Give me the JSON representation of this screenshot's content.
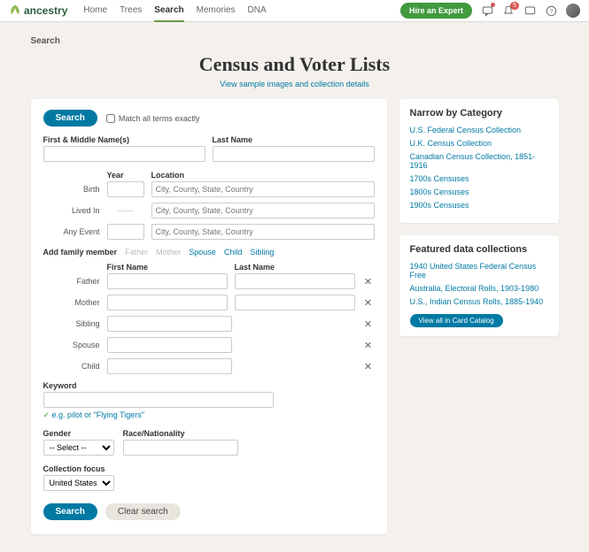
{
  "brand": "ancestry",
  "nav": {
    "home": "Home",
    "trees": "Trees",
    "search": "Search",
    "memories": "Memories",
    "dna": "DNA"
  },
  "hire": "Hire an Expert",
  "notif_count": "5",
  "breadcrumb": "Search",
  "title": "Census and Voter Lists",
  "sample_link": "View sample images and collection details",
  "search_btn": "Search",
  "clear_btn": "Clear search",
  "match_exact": "Match all terms exactly",
  "labels": {
    "first_middle": "First & Middle Name(s)",
    "last_name": "Last Name",
    "year": "Year",
    "location": "Location",
    "birth": "Birth",
    "lived_in": "Lived In",
    "any_event": "Any Event",
    "add_family": "Add family member",
    "first_name": "First Name",
    "father": "Father",
    "mother": "Mother",
    "sibling": "Sibling",
    "spouse": "Spouse",
    "child": "Child",
    "keyword": "Keyword",
    "keyword_tip": "e.g. pilot or \"Flying Tigers\"",
    "gender": "Gender",
    "race": "Race/Nationality",
    "collection_focus": "Collection focus"
  },
  "placeholders": {
    "location": "City, County, State, Country"
  },
  "family_links": {
    "father": "Father",
    "mother": "Mother",
    "spouse": "Spouse",
    "child": "Child",
    "sibling": "Sibling"
  },
  "gender_default": "-- Select --",
  "collection_default": "United States",
  "narrow": {
    "title": "Narrow by Category",
    "items": [
      "U.S. Federal Census Collection",
      "U.K. Census Collection",
      "Canadian Census Collection, 1851-1916",
      "1700s Censuses",
      "1800s Censuses",
      "1900s Censuses"
    ]
  },
  "featured": {
    "title": "Featured data collections",
    "items": [
      "1940 United States Federal Census Free",
      "Australia, Electoral Rolls, 1903-1980",
      "U.S., Indian Census Rolls, 1885-1940"
    ],
    "button": "View all in Card Catalog"
  }
}
